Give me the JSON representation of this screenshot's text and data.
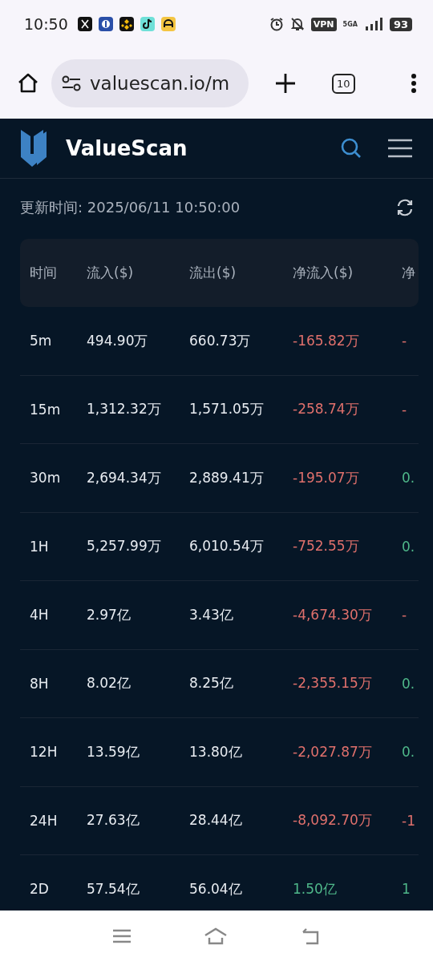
{
  "status_bar": {
    "time": "10:50",
    "vpn": "VPN",
    "network": "5GA",
    "battery": "93"
  },
  "browser": {
    "url": "valuescan.io/m",
    "tab_count": "10"
  },
  "site": {
    "brand": "ValueScan"
  },
  "update": {
    "text": "更新时间: 2025/06/11 10:50:00"
  },
  "table": {
    "columns": [
      "时间",
      "流入($)",
      "流出($)",
      "净流入($)",
      "净"
    ],
    "rows": [
      {
        "cells": [
          {
            "text": "5m"
          },
          {
            "text": "494.90万"
          },
          {
            "text": "660.73万"
          },
          {
            "text": "-165.82万",
            "color": "#e0706c"
          },
          {
            "text": "-",
            "color": "#e0706c"
          }
        ]
      },
      {
        "cells": [
          {
            "text": "15m"
          },
          {
            "text": "1,312.32万"
          },
          {
            "text": "1,571.05万"
          },
          {
            "text": "-258.74万",
            "color": "#e0706c"
          },
          {
            "text": "-",
            "color": "#e0706c"
          }
        ]
      },
      {
        "cells": [
          {
            "text": "30m"
          },
          {
            "text": "2,694.34万"
          },
          {
            "text": "2,889.41万"
          },
          {
            "text": "-195.07万",
            "color": "#e0706c"
          },
          {
            "text": "0.",
            "color": "#4fb88a"
          }
        ]
      },
      {
        "cells": [
          {
            "text": "1H"
          },
          {
            "text": "5,257.99万"
          },
          {
            "text": "6,010.54万"
          },
          {
            "text": "-752.55万",
            "color": "#e0706c"
          },
          {
            "text": "0.",
            "color": "#4fb88a"
          }
        ]
      },
      {
        "cells": [
          {
            "text": "4H"
          },
          {
            "text": "2.97亿"
          },
          {
            "text": "3.43亿"
          },
          {
            "text": "-4,674.30万",
            "color": "#e0706c"
          },
          {
            "text": "-",
            "color": "#e0706c"
          }
        ]
      },
      {
        "cells": [
          {
            "text": "8H"
          },
          {
            "text": "8.02亿"
          },
          {
            "text": "8.25亿"
          },
          {
            "text": "-2,355.15万",
            "color": "#e0706c"
          },
          {
            "text": "0.",
            "color": "#4fb88a"
          }
        ]
      },
      {
        "cells": [
          {
            "text": "12H"
          },
          {
            "text": "13.59亿"
          },
          {
            "text": "13.80亿"
          },
          {
            "text": "-2,027.87万",
            "color": "#e0706c"
          },
          {
            "text": "0.",
            "color": "#4fb88a"
          }
        ]
      },
      {
        "cells": [
          {
            "text": "24H"
          },
          {
            "text": "27.63亿"
          },
          {
            "text": "28.44亿"
          },
          {
            "text": "-8,092.70万",
            "color": "#e0706c"
          },
          {
            "text": "-1",
            "color": "#e0706c"
          }
        ]
      },
      {
        "cells": [
          {
            "text": "2D"
          },
          {
            "text": "57.54亿"
          },
          {
            "text": "56.04亿"
          },
          {
            "text": "1.50亿",
            "color": "#4fb88a"
          },
          {
            "text": "1",
            "color": "#4fb88a"
          }
        ]
      }
    ]
  }
}
